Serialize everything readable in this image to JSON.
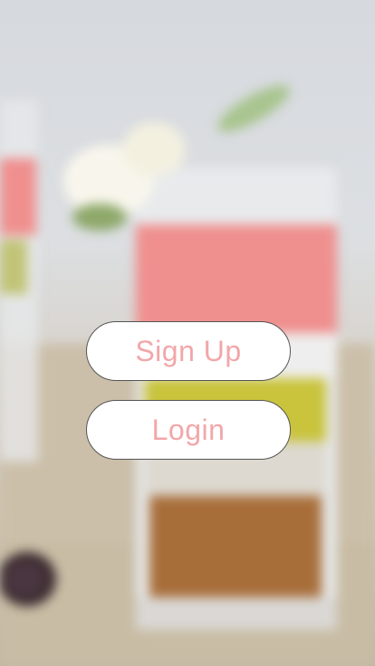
{
  "buttons": {
    "signup_label": "Sign Up",
    "login_label": "Login"
  },
  "colors": {
    "button_text": "#f2a7a9",
    "button_bg": "#ffffff",
    "button_border": "#555555",
    "smoothie": "#ef8f8e"
  },
  "background": {
    "description_icon": "smoothie-glass-photo"
  }
}
